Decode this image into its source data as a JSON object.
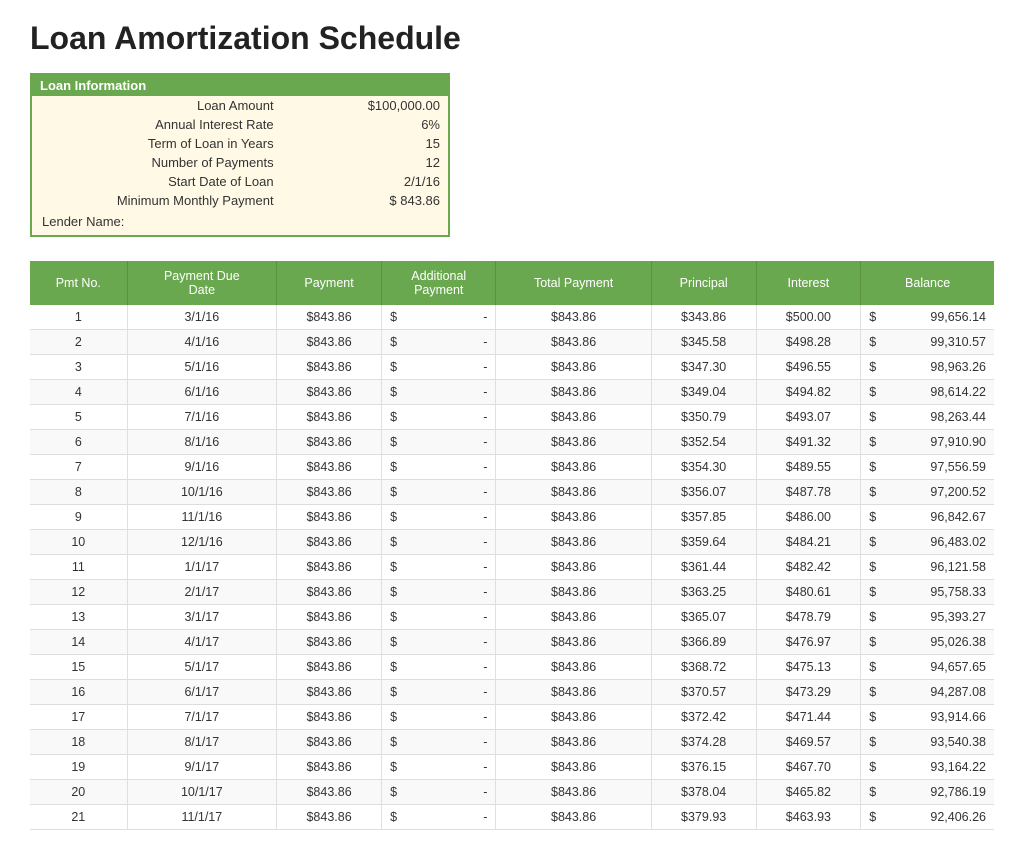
{
  "title": "Loan Amortization Schedule",
  "loanInfo": {
    "header": "Loan Information",
    "fields": [
      {
        "label": "Loan Amount",
        "value": "$100,000.00"
      },
      {
        "label": "Annual Interest Rate",
        "value": "6%"
      },
      {
        "label": "Term of Loan in Years",
        "value": "15"
      },
      {
        "label": "Number of Payments",
        "value": "12"
      },
      {
        "label": "Start Date of Loan",
        "value": "2/1/16"
      },
      {
        "label": "Minimum Monthly Payment",
        "value": "$    843.86",
        "hasDollar": true
      }
    ],
    "lenderLabel": "Lender Name:"
  },
  "table": {
    "headers": [
      "Pmt No.",
      "Payment Due Date",
      "Payment",
      "Additional Payment",
      "Total Payment",
      "Principal",
      "Interest",
      "Balance"
    ],
    "rows": [
      [
        1,
        "3/1/16",
        "$843.86",
        "$",
        "-",
        "$843.86",
        "$343.86",
        "$500.00",
        "$",
        "99,656.14"
      ],
      [
        2,
        "4/1/16",
        "$843.86",
        "$",
        "-",
        "$843.86",
        "$345.58",
        "$498.28",
        "$",
        "99,310.57"
      ],
      [
        3,
        "5/1/16",
        "$843.86",
        "$",
        "-",
        "$843.86",
        "$347.30",
        "$496.55",
        "$",
        "98,963.26"
      ],
      [
        4,
        "6/1/16",
        "$843.86",
        "$",
        "-",
        "$843.86",
        "$349.04",
        "$494.82",
        "$",
        "98,614.22"
      ],
      [
        5,
        "7/1/16",
        "$843.86",
        "$",
        "-",
        "$843.86",
        "$350.79",
        "$493.07",
        "$",
        "98,263.44"
      ],
      [
        6,
        "8/1/16",
        "$843.86",
        "$",
        "-",
        "$843.86",
        "$352.54",
        "$491.32",
        "$",
        "97,910.90"
      ],
      [
        7,
        "9/1/16",
        "$843.86",
        "$",
        "-",
        "$843.86",
        "$354.30",
        "$489.55",
        "$",
        "97,556.59"
      ],
      [
        8,
        "10/1/16",
        "$843.86",
        "$",
        "-",
        "$843.86",
        "$356.07",
        "$487.78",
        "$",
        "97,200.52"
      ],
      [
        9,
        "11/1/16",
        "$843.86",
        "$",
        "-",
        "$843.86",
        "$357.85",
        "$486.00",
        "$",
        "96,842.67"
      ],
      [
        10,
        "12/1/16",
        "$843.86",
        "$",
        "-",
        "$843.86",
        "$359.64",
        "$484.21",
        "$",
        "96,483.02"
      ],
      [
        11,
        "1/1/17",
        "$843.86",
        "$",
        "-",
        "$843.86",
        "$361.44",
        "$482.42",
        "$",
        "96,121.58"
      ],
      [
        12,
        "2/1/17",
        "$843.86",
        "$",
        "-",
        "$843.86",
        "$363.25",
        "$480.61",
        "$",
        "95,758.33"
      ],
      [
        13,
        "3/1/17",
        "$843.86",
        "$",
        "-",
        "$843.86",
        "$365.07",
        "$478.79",
        "$",
        "95,393.27"
      ],
      [
        14,
        "4/1/17",
        "$843.86",
        "$",
        "-",
        "$843.86",
        "$366.89",
        "$476.97",
        "$",
        "95,026.38"
      ],
      [
        15,
        "5/1/17",
        "$843.86",
        "$",
        "-",
        "$843.86",
        "$368.72",
        "$475.13",
        "$",
        "94,657.65"
      ],
      [
        16,
        "6/1/17",
        "$843.86",
        "$",
        "-",
        "$843.86",
        "$370.57",
        "$473.29",
        "$",
        "94,287.08"
      ],
      [
        17,
        "7/1/17",
        "$843.86",
        "$",
        "-",
        "$843.86",
        "$372.42",
        "$471.44",
        "$",
        "93,914.66"
      ],
      [
        18,
        "8/1/17",
        "$843.86",
        "$",
        "-",
        "$843.86",
        "$374.28",
        "$469.57",
        "$",
        "93,540.38"
      ],
      [
        19,
        "9/1/17",
        "$843.86",
        "$",
        "-",
        "$843.86",
        "$376.15",
        "$467.70",
        "$",
        "93,164.22"
      ],
      [
        20,
        "10/1/17",
        "$843.86",
        "$",
        "-",
        "$843.86",
        "$378.04",
        "$465.82",
        "$",
        "92,786.19"
      ],
      [
        21,
        "11/1/17",
        "$843.86",
        "$",
        "-",
        "$843.86",
        "$379.93",
        "$463.93",
        "$",
        "92,406.26"
      ]
    ]
  }
}
